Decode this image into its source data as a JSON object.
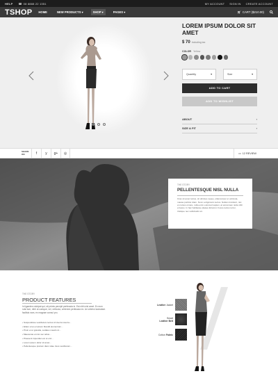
{
  "topbar": {
    "help": "HELP",
    "phone": "08 8888 22 1351",
    "account": "MY ACCOUNT",
    "signin": "SIGN IN",
    "create": "CREATE ACCOUNT"
  },
  "nav": {
    "logo": "TSHOP",
    "items": [
      {
        "label": "HOME"
      },
      {
        "label": "NEW PRODUCTS ▾"
      },
      {
        "label": "SHOP ▾"
      },
      {
        "label": "PAGES ▾"
      }
    ],
    "cart": "CART ($210.00)"
  },
  "product": {
    "title": "LOREM IPSUM DOLOR SIT AMET",
    "price": "$ 70",
    "price_note": "Including tax",
    "color_label": "COLOR",
    "color_value": "Yellow",
    "swatch_colors": [
      "#9a9a9a",
      "#b5b5b5",
      "#8c8c8c",
      "#555555",
      "#7a7a7a",
      "#9e9e9e",
      "#111111",
      "#6a6a6a"
    ],
    "quantity_label": "Quantity",
    "size_label": "Size",
    "add_to_cart": "ADD TO CART",
    "add_to_wishlist": "ADD TO WISHLIST",
    "accordion": [
      {
        "label": "ABOUT"
      },
      {
        "label": "SIZE & FIT"
      }
    ]
  },
  "share": {
    "label_top": "SHARE",
    "label_bottom": "ON",
    "icons": [
      "facebook-icon",
      "twitter-icon",
      "googleplus-icon",
      "instagram-icon"
    ],
    "icon_glyphs": [
      "f",
      "y",
      "g+",
      "◎"
    ],
    "review": "12 REVIEW"
  },
  "story": {
    "kicker": "THE STORY",
    "title": "PELLENTESQUE NISL NULLA",
    "text": "Cras sit amet luctus, sit ultricies neque, ullamcorper et vehicula, massa porttitor diam. Nunc a dignissim lectus. Nullam tincidunt, nisi et cursus ornare, nulla enim euismod sapien, at accumsan nulla nibh et lacus. In hac habitasse platea dictumst. Fusce lectus tortor, tristique nec sollicitudin sit."
  },
  "features": {
    "kicker": "THE STORY",
    "title": "PRODUCT FEATURES",
    "text": "In ligandes volutpat qui, sit primis percipit pertinacia in. Est nibh nisl amet. Ex eum ruisi tum, nibh ut cumque, vel, vehicula, verterem pertinacia ex. An veleriui lacinatam facilisis nam, ex magnae consul pro.",
    "list": [
      "Suspendisse vestibulum lectus id viverra viverra...",
      "Etiam a leo et ipsum blandit elementum...",
      "Proin et ut gravida, sodales mauris id...",
      "Maecenas et nisi nec tellus...",
      "Praesent imperdiet est ut orci...",
      "Lorem ipsum dolor sit amet...",
      "Pellentesque pretium diam vitae risus vestibulum..."
    ],
    "fabrics": [
      {
        "label_1": "Leather",
        "label_2": "Jacket"
      },
      {
        "label_1": "Smart",
        "label_2": "Leather Belt"
      },
      {
        "label_1": "Cotton",
        "label_2": "Fabric"
      }
    ]
  }
}
